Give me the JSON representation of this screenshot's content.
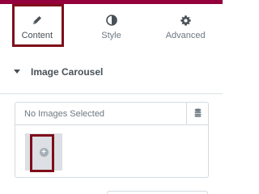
{
  "tabs": [
    {
      "label": "Content",
      "icon": "pencil-icon",
      "active": true
    },
    {
      "label": "Style",
      "icon": "contrast-icon",
      "active": false
    },
    {
      "label": "Advanced",
      "icon": "gear-icon",
      "active": false
    }
  ],
  "section": {
    "title": "Image Carousel"
  },
  "gallery": {
    "status_text": "No Images Selected",
    "menu_icon": "database-icon",
    "add_icon": "plus-circle-icon"
  },
  "colors": {
    "accent": "#93003c",
    "highlight": "#7f0d1a"
  }
}
